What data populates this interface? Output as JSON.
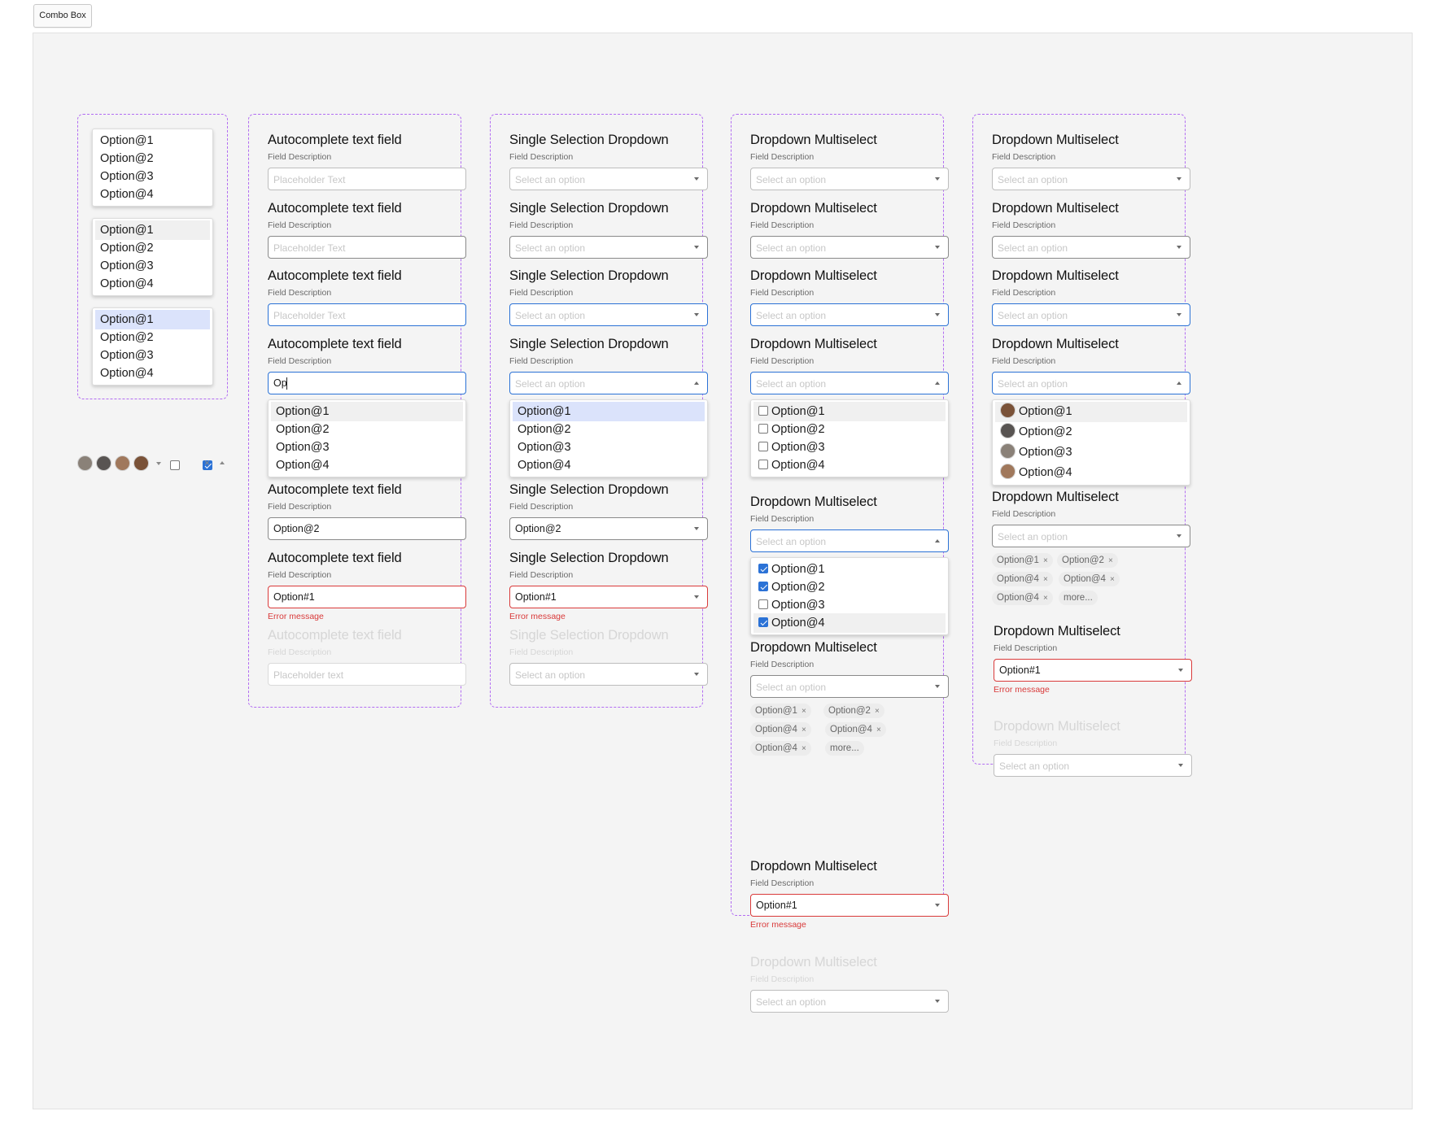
{
  "frame_label": "Combo Box",
  "options": [
    "Option@1",
    "Option@2",
    "Option@3",
    "Option@4"
  ],
  "placeholders": {
    "text_caps": "Placeholder Text",
    "text_lower": "Placeholder text",
    "select": "Select an option"
  },
  "labels": {
    "autocomplete": "Autocomplete text field",
    "single": "Single Selection Dropdown",
    "multi": "Dropdown Multiselect",
    "desc": "Field Description",
    "error": "Error message"
  },
  "values": {
    "typed": "Op",
    "selected": "Option@2",
    "invalid": "Option#1"
  },
  "chips": {
    "row1": [
      "Option@1",
      "Option@2"
    ],
    "row2": [
      "Option@4",
      "Option@4"
    ],
    "row3": [
      "Option@4"
    ],
    "more": "more..."
  },
  "chip_remove_glyph": "×",
  "multiselect_checked": [
    false,
    false,
    false,
    false
  ],
  "multiselect_checked_2": [
    true,
    true,
    false,
    true
  ],
  "icons": {
    "avatars": [
      "avatar-1-icon",
      "avatar-2-icon",
      "avatar-3-icon",
      "avatar-4-icon"
    ],
    "caret_down": "chevron-down-icon",
    "checkbox_empty": "checkbox-empty-icon",
    "checkbox_checked": "checkbox-checked-icon",
    "close": "close-icon",
    "caret_up": "chevron-up-icon"
  },
  "colors": {
    "accent": "#2b72d6",
    "error": "#d93a3a",
    "group_border": "#b26cf2",
    "selected_bg": "#dbe3fb"
  }
}
